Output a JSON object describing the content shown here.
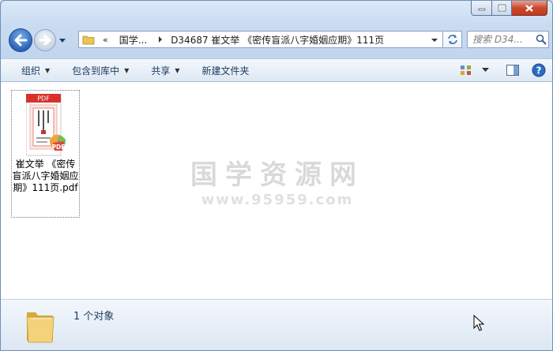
{
  "window": {
    "caption": {
      "minimize_icon": "minimize-icon",
      "maximize_icon": "maximize-icon",
      "close_icon": "close-icon"
    }
  },
  "navigation": {
    "back_icon": "arrow-left-icon",
    "forward_icon": "arrow-right-icon",
    "overflow": "«",
    "crumbs": [
      "国学...",
      "D34687 崔文举 《密传盲派八字婚姻应期》111页"
    ],
    "search_placeholder": "搜索 D34...",
    "search_icon": "magnifier-icon"
  },
  "toolbar": {
    "organize": "组织",
    "include_in_library": "包含到库中",
    "share": "共享",
    "new_folder": "新建文件夹"
  },
  "files": [
    {
      "name": "崔文举 《密传盲派八字婚姻应期》111页.pdf",
      "badge_top": "PDF",
      "badge_corner": "PDF"
    }
  ],
  "watermark": {
    "title": "国学资源网",
    "url": "www.95959.com"
  },
  "details": {
    "count": "1 个对象"
  },
  "colors": {
    "pdf_red": "#d8312b",
    "accent_blue": "#2a63b8"
  }
}
